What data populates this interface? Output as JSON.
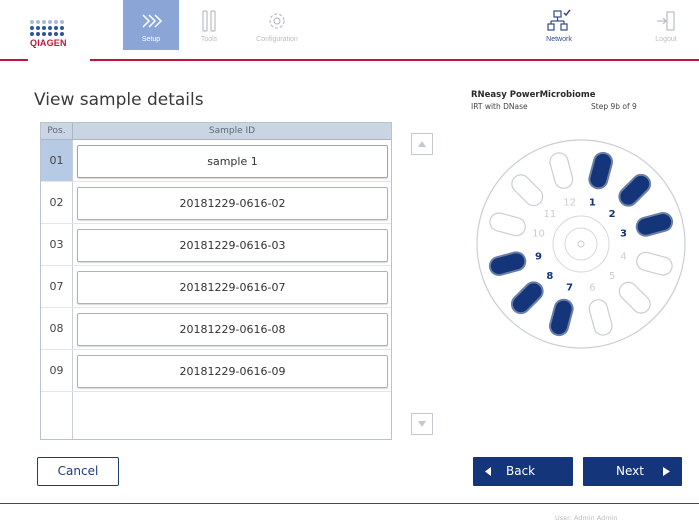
{
  "header": {
    "logo_text": "QIAGEN",
    "nav": {
      "setup": "Setup",
      "tools": "Tools",
      "configuration": "Configuration",
      "network": "Network",
      "logout": "Logout"
    }
  },
  "page": {
    "title": "View sample details"
  },
  "table": {
    "col_pos": "Pos.",
    "col_sample": "Sample ID",
    "rows": [
      {
        "pos": "01",
        "sample": "sample 1",
        "selected": true
      },
      {
        "pos": "02",
        "sample": "20181229-0616-02"
      },
      {
        "pos": "03",
        "sample": "20181229-0616-03"
      },
      {
        "pos": "07",
        "sample": "20181229-0616-07"
      },
      {
        "pos": "08",
        "sample": "20181229-0616-08"
      },
      {
        "pos": "09",
        "sample": "20181229-0616-09"
      }
    ]
  },
  "protocol": {
    "name": "RNeasy PowerMicrobiome",
    "variant": "IRT with DNase",
    "step": "Step 9b of 9"
  },
  "rotor": {
    "slots": [
      "1",
      "2",
      "3",
      "4",
      "5",
      "6",
      "7",
      "8",
      "9",
      "10",
      "11",
      "12"
    ],
    "occupied": [
      "1",
      "2",
      "3",
      "7",
      "8",
      "9"
    ],
    "occupied_color": "#14357a"
  },
  "buttons": {
    "cancel": "Cancel",
    "back": "Back",
    "next": "Next"
  },
  "footer": {
    "user": "User: Admin Admin"
  },
  "colors": {
    "brand_red": "#c0143c",
    "brand_blue": "#14357a",
    "active_nav": "#8ba6d6"
  }
}
